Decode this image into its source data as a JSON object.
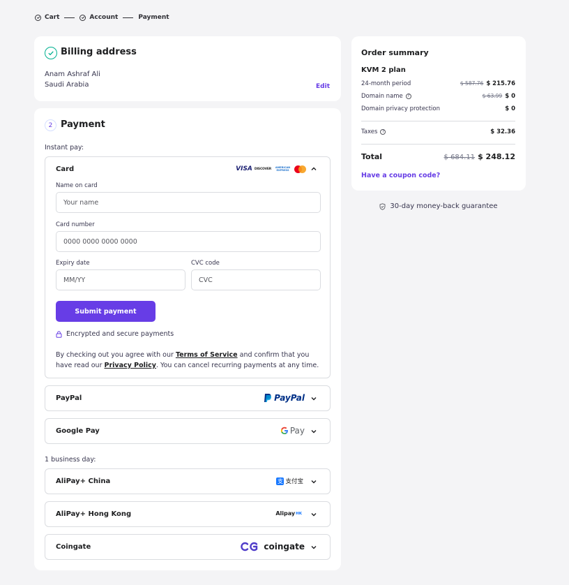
{
  "breadcrumb": {
    "steps": [
      "Cart",
      "Account",
      "Payment"
    ]
  },
  "billing": {
    "title": "Billing address",
    "name": "Anam Ashraf Ali",
    "country": "Saudi Arabia",
    "edit_label": "Edit"
  },
  "payment": {
    "step_number": "2",
    "title": "Payment",
    "instant_label": "Instant pay:",
    "business_label": "1 business day:",
    "card": {
      "title": "Card",
      "name_label": "Name on card",
      "name_placeholder": "Your name",
      "number_label": "Card number",
      "number_placeholder": "0000 0000 0000 0000",
      "expiry_label": "Expiry date",
      "expiry_placeholder": "MM/YY",
      "cvc_label": "CVC code",
      "cvc_placeholder": "CVC",
      "submit_label": "Submit payment",
      "secure_text": "Encrypted and secure payments",
      "terms_pre": "By checking out you agree with our ",
      "terms_link": "Terms of Service",
      "terms_mid": " and confirm that you have read our ",
      "privacy_link": "Privacy Policy",
      "terms_post": ". You can cancel recurring payments at any time.",
      "brand_logos": [
        "VISA",
        "DISCOVER",
        "AMERICAN EXPRESS",
        "mastercard"
      ]
    },
    "methods_instant": [
      {
        "label": "PayPal",
        "logo": "PayPal"
      },
      {
        "label": "Google Pay",
        "logo": "Pay"
      }
    ],
    "methods_business": [
      {
        "label": "AliPay+ China",
        "logo": "支付宝"
      },
      {
        "label": "AliPay+ Hong Kong",
        "logo": "Alipay",
        "logo_suffix": "HK"
      },
      {
        "label": "Coingate",
        "logo": "coingate"
      }
    ]
  },
  "summary": {
    "title": "Order summary",
    "plan": "KVM 2 plan",
    "period_label": "24-month period",
    "period_old": "$ 587.76",
    "period_price": "$ 215.76",
    "domain_label": "Domain name",
    "domain_old": "$ 63.99",
    "domain_price": "$ 0",
    "privacy_label": "Domain privacy protection",
    "privacy_price": "$ 0",
    "taxes_label": "Taxes",
    "taxes_price": "$ 32.36",
    "total_label": "Total",
    "total_old": "$ 684.11",
    "total_price": "$ 248.12",
    "coupon_label": "Have a coupon code?"
  },
  "guarantee": "30-day money-back guarantee",
  "colors": {
    "accent": "#673de6",
    "success": "#00b090",
    "background": "#f4f4f6"
  }
}
